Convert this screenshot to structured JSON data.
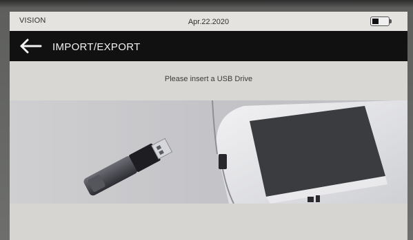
{
  "status_bar": {
    "brand": "VISION",
    "date": "Apr.22.2020",
    "battery_icon": "battery-icon"
  },
  "header": {
    "back_icon": "arrow-left-icon",
    "title": "IMPORT/EXPORT"
  },
  "main": {
    "prompt": "Please insert a USB Drive",
    "illustration_icon": "usb-drive-insertion-illustration"
  },
  "colors": {
    "title_bar": "#111111",
    "screen_bg": "#dad9d4"
  }
}
